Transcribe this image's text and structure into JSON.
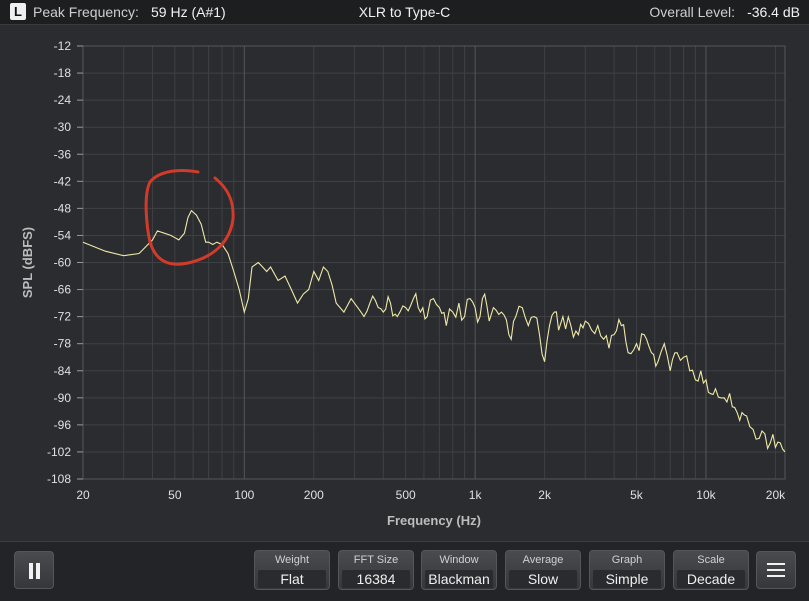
{
  "header": {
    "channel": "L",
    "peak_label": "Peak Frequency:",
    "peak_value": "59 Hz (A#1)",
    "title": "XLR to Type-C",
    "level_label": "Overall Level:",
    "level_value": "-36.4 dB"
  },
  "chart_data": {
    "type": "line",
    "title": "",
    "xlabel": "Frequency (Hz)",
    "ylabel": "SPL (dBFS)",
    "x_scale": "log",
    "xlim": [
      20,
      22000
    ],
    "ylim": [
      -108,
      -12
    ],
    "grid": true,
    "xticks": [
      {
        "v": 20,
        "label": "20"
      },
      {
        "v": 50,
        "label": "50"
      },
      {
        "v": 100,
        "label": "100"
      },
      {
        "v": 200,
        "label": "200"
      },
      {
        "v": 500,
        "label": "500"
      },
      {
        "v": 1000,
        "label": "1k"
      },
      {
        "v": 2000,
        "label": "2k"
      },
      {
        "v": 5000,
        "label": "5k"
      },
      {
        "v": 10000,
        "label": "10k"
      },
      {
        "v": 20000,
        "label": "20k"
      }
    ],
    "yticks": [
      -12,
      -18,
      -24,
      -30,
      -36,
      -42,
      -48,
      -54,
      -60,
      -66,
      -72,
      -78,
      -84,
      -90,
      -96,
      -102,
      -108
    ],
    "series": [
      {
        "color": "#efe9a8",
        "x": [
          20,
          25,
          30,
          35,
          40,
          42,
          45,
          48,
          50,
          52,
          55,
          57,
          59,
          62,
          65,
          68,
          70,
          73,
          76,
          80,
          85,
          90,
          95,
          100,
          104,
          108,
          115,
          120,
          125,
          130,
          140,
          150,
          160,
          170,
          180,
          190,
          200,
          210,
          220,
          230,
          240,
          250,
          270,
          290,
          310,
          330,
          350,
          380,
          400,
          430,
          460,
          500,
          540,
          580,
          620,
          660,
          700,
          750,
          800,
          850,
          900,
          950,
          1000,
          1050,
          1100,
          1150,
          1200,
          1300,
          1400,
          1500,
          1600,
          1700,
          1800,
          1900,
          2000,
          2100,
          2200,
          2300,
          2400,
          2600,
          2800,
          3000,
          3200,
          3400,
          3600,
          3800,
          4000,
          4300,
          4600,
          5000,
          5400,
          5800,
          6200,
          6600,
          7000,
          7500,
          8000,
          8500,
          9000,
          9500,
          10000,
          11000,
          12000,
          13000,
          14000,
          15000,
          16000,
          17000,
          18000,
          19000,
          20000,
          21000,
          22000
        ],
        "y": [
          -55.5,
          -57.5,
          -58.5,
          -58,
          -55,
          -53,
          -53.5,
          -54,
          -54.5,
          -55,
          -53.5,
          -50,
          -48.5,
          -49.5,
          -51.5,
          -55.5,
          -55.5,
          -56,
          -55.5,
          -56,
          -58,
          -62,
          -66,
          -71,
          -68,
          -61,
          -60,
          -61,
          -62,
          -61,
          -64,
          -63,
          -66,
          -69,
          -67,
          -66,
          -62,
          -64,
          -61,
          -62,
          -65,
          -69,
          -71,
          -68,
          -70,
          -72,
          -69,
          -70,
          -71,
          -69,
          -72,
          -70,
          -68,
          -71,
          -72,
          -68,
          -70,
          -74,
          -71,
          -69,
          -72,
          -68,
          -70,
          -72,
          -67,
          -73,
          -70,
          -71,
          -76,
          -72,
          -70,
          -74,
          -72,
          -76,
          -82,
          -74,
          -71,
          -75,
          -72,
          -74,
          -76,
          -73,
          -75,
          -74,
          -77,
          -79,
          -76,
          -74,
          -80,
          -78,
          -76,
          -80,
          -82,
          -78,
          -84,
          -80,
          -81,
          -84,
          -86,
          -84,
          -86,
          -88,
          -90,
          -92,
          -95,
          -94,
          -97,
          -99,
          -98,
          -100,
          -101,
          -100,
          -102
        ]
      }
    ]
  },
  "controls": {
    "weight": {
      "label": "Weight",
      "value": "Flat"
    },
    "fft": {
      "label": "FFT Size",
      "value": "16384"
    },
    "window": {
      "label": "Window",
      "value": "Blackman"
    },
    "average": {
      "label": "Average",
      "value": "Slow"
    },
    "graph": {
      "label": "Graph",
      "value": "Simple"
    },
    "scale": {
      "label": "Scale",
      "value": "Decade"
    }
  },
  "colors": {
    "curve": "#efe9a8",
    "annotation": "#d23a2a",
    "plot_background": "#2b2c2f",
    "grid": "#3f4043"
  }
}
